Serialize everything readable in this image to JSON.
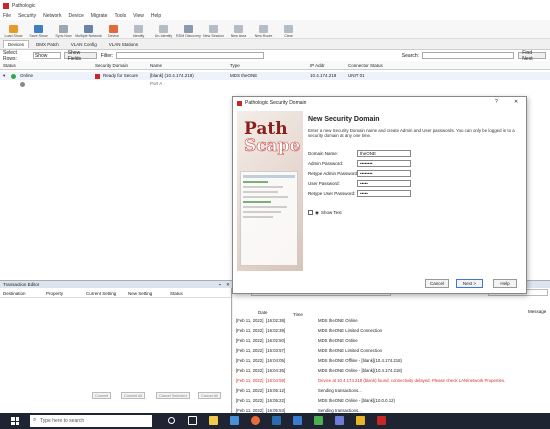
{
  "app": {
    "title": "Pathologic"
  },
  "menu": [
    "File",
    "Security",
    "Network",
    "Device",
    "Migrate",
    "Tools",
    "View",
    "Help"
  ],
  "toolbar": [
    {
      "label": "Load Show",
      "color": "#e69a2a"
    },
    {
      "label": "Save Show",
      "color": "#3f7fbf"
    },
    {
      "label": "Sync Now",
      "color": "#9aa7b5"
    },
    {
      "label": "Multiple Network",
      "color": "#6c83a8"
    },
    {
      "label": "Device",
      "color": "#e26b3a"
    },
    {
      "label": "Identify",
      "color": "#b6bcc5"
    },
    {
      "label": "Un-Identify",
      "color": "#b6bcc5"
    },
    {
      "label": "RDM Discovery",
      "color": "#8a9ab0"
    },
    {
      "label": "New Session",
      "color": "#b6bcc5"
    },
    {
      "label": "New Area",
      "color": "#b6bcc5"
    },
    {
      "label": "New Route",
      "color": "#b6bcc5"
    },
    {
      "label": "Clear",
      "color": "#b6bcc5"
    }
  ],
  "tabs": [
    "Devices",
    "DMX Patch",
    "VLAN Config",
    "VLAN Stations"
  ],
  "filterbar": {
    "select_label": "Select Rows:",
    "select_value": "Show",
    "show_fields": "Show Fields",
    "filter_label": "Filter:",
    "search_label": "Search:",
    "find_next": "Find Next"
  },
  "grid": {
    "headers": [
      "Status",
      "Security Domain",
      "Name",
      "Type",
      "IP Addr",
      "Connector Status"
    ],
    "rows": [
      {
        "status": "Online",
        "domain": "Ready for Secure",
        "name": "[blank] (10.4.174.218)",
        "type": "MDS theONE",
        "ip": "10.4.174.218",
        "conn": "UNIT 01"
      },
      {
        "status": "",
        "domain": "",
        "name": "Port A",
        "type": "",
        "ip": "",
        "conn": ""
      }
    ]
  },
  "txpanel": {
    "title": "Transaction Editor",
    "headers": [
      "Destination",
      "Property",
      "Current Setting",
      "New Setting",
      "Status"
    ],
    "buttons": [
      "Commit",
      "Commit All",
      "Cancel Selected",
      "Cancel All"
    ]
  },
  "msgpanel": {
    "title": "Message Viewer",
    "filter_label": "Filter:",
    "search_label": "Search:",
    "col_date": "Date",
    "col_time": "Time",
    "col_message": "Message",
    "rows": [
      {
        "date": "[Feb 11, 2022]",
        "time": "[16:02:38]",
        "msg": "MDS theONE Online",
        "color": "#222"
      },
      {
        "date": "[Feb 11, 2022]",
        "time": "[16:02:39]",
        "msg": "MDS theONE Limited Connection",
        "color": "#222"
      },
      {
        "date": "[Feb 11, 2022]",
        "time": "[16:02:50]",
        "msg": "MDS theONE Online",
        "color": "#222"
      },
      {
        "date": "[Feb 11, 2022]",
        "time": "[16:03:57]",
        "msg": "MDS theONE Limited Connection",
        "color": "#222"
      },
      {
        "date": "[Feb 11, 2022]",
        "time": "[16:04:05]",
        "msg": "MDS theONE Offline - [blank](10.4.174.218)",
        "color": "#222"
      },
      {
        "date": "[Feb 11, 2022]",
        "time": "[16:04:35]",
        "msg": "MDS theONE Online - [blank](10.4.174.218)",
        "color": "#222"
      },
      {
        "date": "[Feb 11, 2022]",
        "time": "[16:04:59]",
        "msg": "Device at 10.4.174.218 (blank) found, connectivity delayed. Please check LAN/network Properties.",
        "color": "#d32f2f"
      },
      {
        "date": "[Feb 11, 2022]",
        "time": "[16:05:12]",
        "msg": "Sending transactions...",
        "color": "#222"
      },
      {
        "date": "[Feb 11, 2022]",
        "time": "[16:05:22]",
        "msg": "MDS theONE Online - [blank](10.0.0.12)",
        "color": "#222"
      },
      {
        "date": "[Feb 11, 2022]",
        "time": "[16:05:53]",
        "msg": "Sending transactions...",
        "color": "#222"
      }
    ]
  },
  "dialog": {
    "title": "Pathologic Security Domain",
    "heading": "New Security Domain",
    "description": "Enter a new Security Domain name and create Admin and User passwords. You can only be logged in to a security domain at any one time.",
    "brand_top": "Path",
    "brand_bottom": "Scape",
    "fields": [
      {
        "label": "Domain Name:",
        "value": "theONE"
      },
      {
        "label": "Admin Password:",
        "value": "••••••••"
      },
      {
        "label": "Retype Admin Password:",
        "value": "••••••••"
      },
      {
        "label": "User Password:",
        "value": "•••••"
      },
      {
        "label": "Retype User Password:",
        "value": "•••••"
      }
    ],
    "show_text": "Show Text",
    "buttons": {
      "cancel": "Cancel",
      "next": "Next >",
      "help": "Help"
    }
  },
  "taskbar": {
    "search_placeholder": "Type here to search"
  }
}
